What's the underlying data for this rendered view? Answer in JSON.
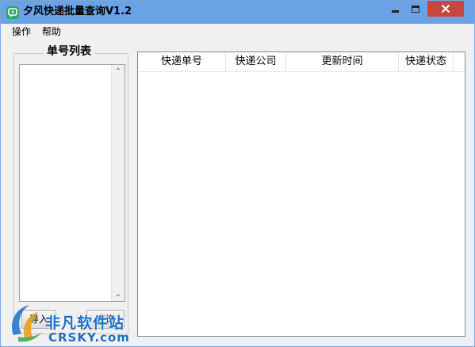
{
  "window": {
    "title": "夕风快递批量查询V1.2"
  },
  "menu": {
    "items": [
      "操作",
      "帮助"
    ]
  },
  "sidebar": {
    "group_title": "单号列表",
    "import_button": "导入",
    "query_button": "查询"
  },
  "table": {
    "columns": [
      "快递单号",
      "快递公司",
      "更新时间",
      "快递状态"
    ],
    "rows": []
  },
  "watermark": {
    "cn_text": "非凡软件站",
    "en_text": "CRSKY.com"
  },
  "colors": {
    "titlebar": "#6aa2e8",
    "close_button": "#c7463d",
    "app_icon": "#2ea56d",
    "watermark": "#1d6fc5"
  }
}
